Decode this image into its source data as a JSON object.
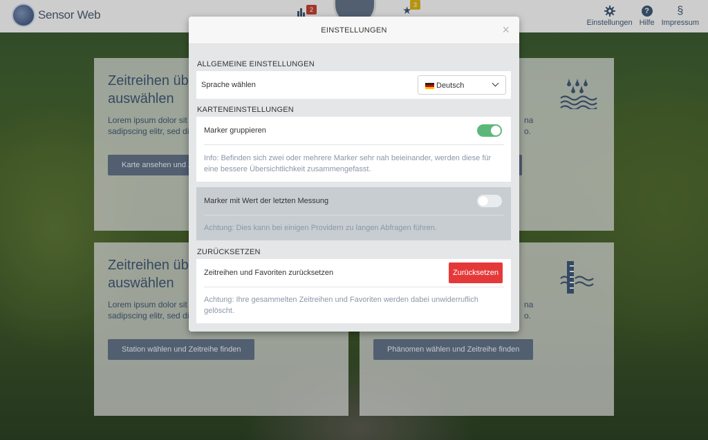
{
  "navbar": {
    "brand": "Sensor Web",
    "chart_badge": "2",
    "favorites_badge": "3",
    "items": [
      {
        "label": "Einstellungen",
        "icon": "gear-icon"
      },
      {
        "label": "Hilfe",
        "icon": "help-icon"
      },
      {
        "label": "Impressum",
        "icon": "section-icon",
        "glyph": "§"
      }
    ]
  },
  "cards": [
    {
      "title_lines": [
        "Zeitreihen üb",
        "auswählen"
      ],
      "text_lines": [
        "Lorem ipsum dolor sit",
        "sadipscing elitr, sed di"
      ],
      "button": "Karte ansehen und Ze"
    },
    {
      "text_lines": [
        "na",
        "o."
      ]
    },
    {
      "title_lines": [
        "Zeitreihen üb",
        "auswählen"
      ],
      "text_lines": [
        "Lorem ipsum dolor sit",
        "sadipscing elitr, sed di"
      ],
      "button": "Station wählen und Zeitreihe finden"
    },
    {
      "text_lines": [
        "na",
        "o."
      ],
      "button": "Phänomen wählen und Zeitreihe finden"
    }
  ],
  "modal": {
    "title": "EINSTELLUNGEN",
    "close": "×",
    "general": {
      "title": "ALLGEMEINE EINSTELLUNGEN",
      "language_label": "Sprache wählen",
      "language_value": "Deutsch"
    },
    "map": {
      "title": "KARTENEINSTELLUNGEN",
      "group_label": "Marker gruppieren",
      "group_on": true,
      "group_info": "Info: Befinden sich zwei oder mehrere Marker sehr nah beieinander, werden diese für eine bessere Übersichtlichkeit zusammengefasst.",
      "lastvalue_label": "Marker mit Wert der letzten Messung",
      "lastvalue_on": false,
      "lastvalue_info": "Achtung: Dies kann bei einigen Providern zu langen Abfragen führen."
    },
    "reset": {
      "title": "ZURÜCKSETZEN",
      "label": "Zeitreihen und Favoriten zurücksetzen",
      "button": "Zurücksetzen",
      "info": "Achtung: Ihre gesammelten Zeitreihen und Favoriten werden dabei unwiderruflich gelöscht."
    }
  },
  "colors": {
    "accent": "#5cb87a",
    "danger": "#e53939",
    "chart_badge": "#c0392b",
    "favorites_badge": "#d4ac0d"
  }
}
